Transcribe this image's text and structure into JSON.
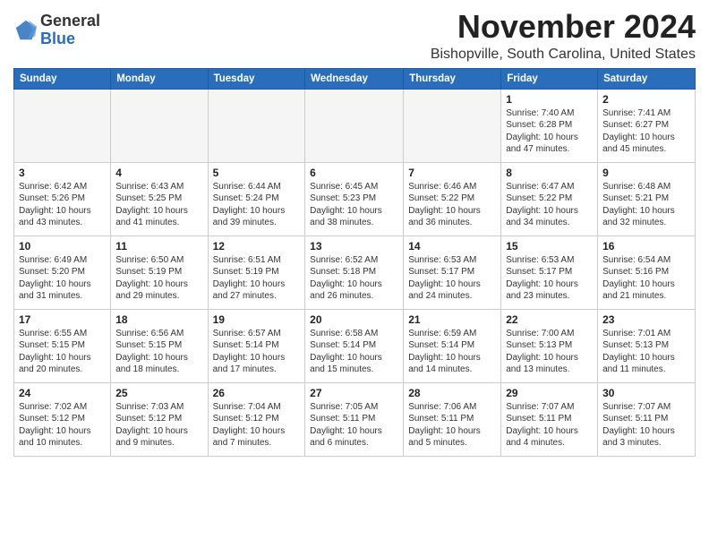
{
  "logo": {
    "general": "General",
    "blue": "Blue"
  },
  "header": {
    "month_title": "November 2024",
    "location": "Bishopville, South Carolina, United States"
  },
  "weekdays": [
    "Sunday",
    "Monday",
    "Tuesday",
    "Wednesday",
    "Thursday",
    "Friday",
    "Saturday"
  ],
  "weeks": [
    [
      {
        "day": "",
        "info": ""
      },
      {
        "day": "",
        "info": ""
      },
      {
        "day": "",
        "info": ""
      },
      {
        "day": "",
        "info": ""
      },
      {
        "day": "",
        "info": ""
      },
      {
        "day": "1",
        "info": "Sunrise: 7:40 AM\nSunset: 6:28 PM\nDaylight: 10 hours\nand 47 minutes."
      },
      {
        "day": "2",
        "info": "Sunrise: 7:41 AM\nSunset: 6:27 PM\nDaylight: 10 hours\nand 45 minutes."
      }
    ],
    [
      {
        "day": "3",
        "info": "Sunrise: 6:42 AM\nSunset: 5:26 PM\nDaylight: 10 hours\nand 43 minutes."
      },
      {
        "day": "4",
        "info": "Sunrise: 6:43 AM\nSunset: 5:25 PM\nDaylight: 10 hours\nand 41 minutes."
      },
      {
        "day": "5",
        "info": "Sunrise: 6:44 AM\nSunset: 5:24 PM\nDaylight: 10 hours\nand 39 minutes."
      },
      {
        "day": "6",
        "info": "Sunrise: 6:45 AM\nSunset: 5:23 PM\nDaylight: 10 hours\nand 38 minutes."
      },
      {
        "day": "7",
        "info": "Sunrise: 6:46 AM\nSunset: 5:22 PM\nDaylight: 10 hours\nand 36 minutes."
      },
      {
        "day": "8",
        "info": "Sunrise: 6:47 AM\nSunset: 5:22 PM\nDaylight: 10 hours\nand 34 minutes."
      },
      {
        "day": "9",
        "info": "Sunrise: 6:48 AM\nSunset: 5:21 PM\nDaylight: 10 hours\nand 32 minutes."
      }
    ],
    [
      {
        "day": "10",
        "info": "Sunrise: 6:49 AM\nSunset: 5:20 PM\nDaylight: 10 hours\nand 31 minutes."
      },
      {
        "day": "11",
        "info": "Sunrise: 6:50 AM\nSunset: 5:19 PM\nDaylight: 10 hours\nand 29 minutes."
      },
      {
        "day": "12",
        "info": "Sunrise: 6:51 AM\nSunset: 5:19 PM\nDaylight: 10 hours\nand 27 minutes."
      },
      {
        "day": "13",
        "info": "Sunrise: 6:52 AM\nSunset: 5:18 PM\nDaylight: 10 hours\nand 26 minutes."
      },
      {
        "day": "14",
        "info": "Sunrise: 6:53 AM\nSunset: 5:17 PM\nDaylight: 10 hours\nand 24 minutes."
      },
      {
        "day": "15",
        "info": "Sunrise: 6:53 AM\nSunset: 5:17 PM\nDaylight: 10 hours\nand 23 minutes."
      },
      {
        "day": "16",
        "info": "Sunrise: 6:54 AM\nSunset: 5:16 PM\nDaylight: 10 hours\nand 21 minutes."
      }
    ],
    [
      {
        "day": "17",
        "info": "Sunrise: 6:55 AM\nSunset: 5:15 PM\nDaylight: 10 hours\nand 20 minutes."
      },
      {
        "day": "18",
        "info": "Sunrise: 6:56 AM\nSunset: 5:15 PM\nDaylight: 10 hours\nand 18 minutes."
      },
      {
        "day": "19",
        "info": "Sunrise: 6:57 AM\nSunset: 5:14 PM\nDaylight: 10 hours\nand 17 minutes."
      },
      {
        "day": "20",
        "info": "Sunrise: 6:58 AM\nSunset: 5:14 PM\nDaylight: 10 hours\nand 15 minutes."
      },
      {
        "day": "21",
        "info": "Sunrise: 6:59 AM\nSunset: 5:14 PM\nDaylight: 10 hours\nand 14 minutes."
      },
      {
        "day": "22",
        "info": "Sunrise: 7:00 AM\nSunset: 5:13 PM\nDaylight: 10 hours\nand 13 minutes."
      },
      {
        "day": "23",
        "info": "Sunrise: 7:01 AM\nSunset: 5:13 PM\nDaylight: 10 hours\nand 11 minutes."
      }
    ],
    [
      {
        "day": "24",
        "info": "Sunrise: 7:02 AM\nSunset: 5:12 PM\nDaylight: 10 hours\nand 10 minutes."
      },
      {
        "day": "25",
        "info": "Sunrise: 7:03 AM\nSunset: 5:12 PM\nDaylight: 10 hours\nand 9 minutes."
      },
      {
        "day": "26",
        "info": "Sunrise: 7:04 AM\nSunset: 5:12 PM\nDaylight: 10 hours\nand 7 minutes."
      },
      {
        "day": "27",
        "info": "Sunrise: 7:05 AM\nSunset: 5:11 PM\nDaylight: 10 hours\nand 6 minutes."
      },
      {
        "day": "28",
        "info": "Sunrise: 7:06 AM\nSunset: 5:11 PM\nDaylight: 10 hours\nand 5 minutes."
      },
      {
        "day": "29",
        "info": "Sunrise: 7:07 AM\nSunset: 5:11 PM\nDaylight: 10 hours\nand 4 minutes."
      },
      {
        "day": "30",
        "info": "Sunrise: 7:07 AM\nSunset: 5:11 PM\nDaylight: 10 hours\nand 3 minutes."
      }
    ]
  ]
}
